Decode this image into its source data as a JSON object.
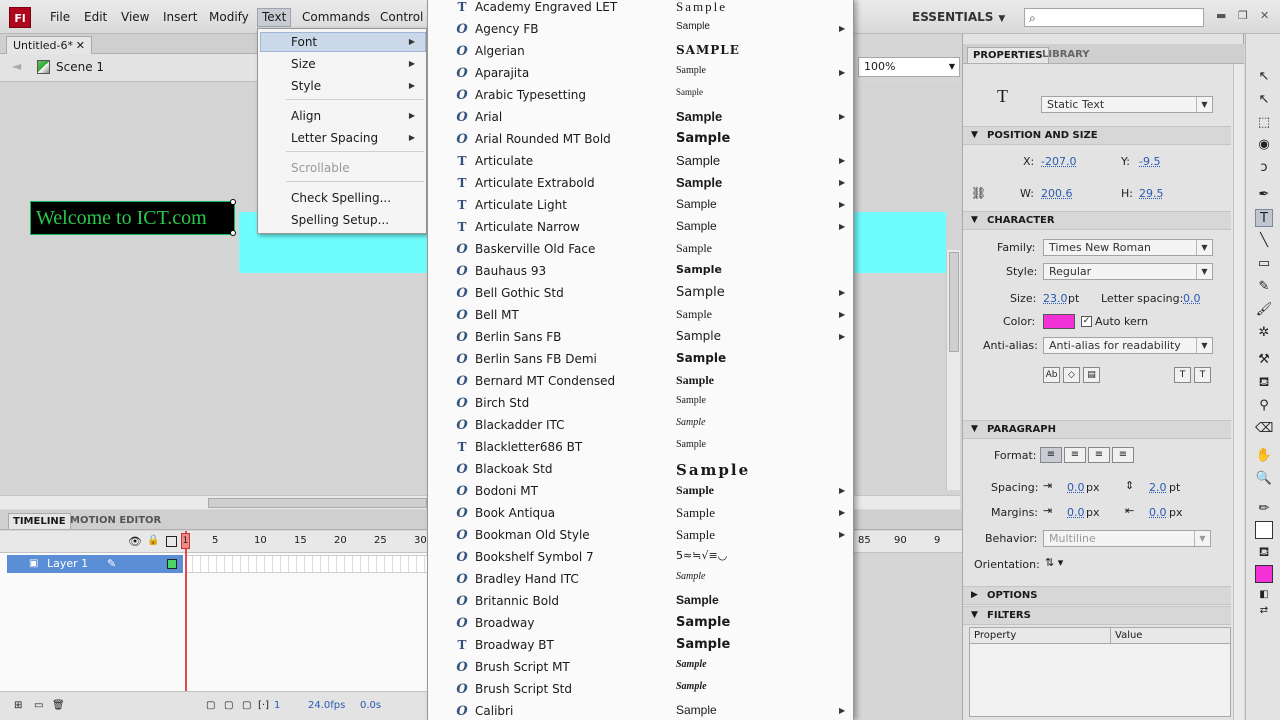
{
  "app": {
    "logo": "Fl"
  },
  "menubar": {
    "items": [
      "File",
      "Edit",
      "View",
      "Insert",
      "Modify",
      "Text",
      "Commands",
      "Control"
    ],
    "workspace": "ESSENTIALS"
  },
  "document": {
    "tab": "Untitled-6*",
    "scene": "Scene 1",
    "zoom": "100%",
    "text_object": "Welcome to ICT.com"
  },
  "text_menu": {
    "font": "Font",
    "size": "Size",
    "style": "Style",
    "align": "Align",
    "letter_spacing": "Letter Spacing",
    "scrollable": "Scrollable",
    "check_spelling": "Check Spelling...",
    "spelling_setup": "Spelling Setup..."
  },
  "font_list": [
    {
      "name": "Academy Engraved LET",
      "type": "TT",
      "sample": "Sample",
      "submenu": false
    },
    {
      "name": "Agency FB",
      "type": "O",
      "sample": "Sample",
      "submenu": true
    },
    {
      "name": "Algerian",
      "type": "O",
      "sample": "SAMPLE",
      "submenu": false
    },
    {
      "name": "Aparajita",
      "type": "O",
      "sample": "Sample",
      "submenu": true
    },
    {
      "name": "Arabic Typesetting",
      "type": "O",
      "sample": "Sample",
      "submenu": false
    },
    {
      "name": "Arial",
      "type": "O",
      "sample": "Sample",
      "submenu": true
    },
    {
      "name": "Arial Rounded MT Bold",
      "type": "O",
      "sample": "Sample",
      "submenu": false
    },
    {
      "name": "Articulate",
      "type": "TT",
      "sample": "Sample",
      "submenu": true
    },
    {
      "name": "Articulate Extrabold",
      "type": "TT",
      "sample": "Sample",
      "submenu": true
    },
    {
      "name": "Articulate Light",
      "type": "TT",
      "sample": "Sample",
      "submenu": true
    },
    {
      "name": "Articulate Narrow",
      "type": "TT",
      "sample": "Sample",
      "submenu": true
    },
    {
      "name": "Baskerville Old Face",
      "type": "O",
      "sample": "Sample",
      "submenu": false
    },
    {
      "name": "Bauhaus 93",
      "type": "O",
      "sample": "Sample",
      "submenu": false
    },
    {
      "name": "Bell Gothic Std",
      "type": "O",
      "sample": "Sample",
      "submenu": true
    },
    {
      "name": "Bell MT",
      "type": "O",
      "sample": "Sample",
      "submenu": true
    },
    {
      "name": "Berlin Sans FB",
      "type": "O",
      "sample": "Sample",
      "submenu": true
    },
    {
      "name": "Berlin Sans FB Demi",
      "type": "O",
      "sample": "Sample",
      "submenu": false
    },
    {
      "name": "Bernard MT Condensed",
      "type": "O",
      "sample": "Sample",
      "submenu": false
    },
    {
      "name": "Birch Std",
      "type": "O",
      "sample": "Sample",
      "submenu": false
    },
    {
      "name": "Blackadder ITC",
      "type": "O",
      "sample": "Sample",
      "submenu": false
    },
    {
      "name": "Blackletter686 BT",
      "type": "TT",
      "sample": "Sample",
      "submenu": false
    },
    {
      "name": "Blackoak Std",
      "type": "O",
      "sample": "Sample",
      "submenu": false
    },
    {
      "name": "Bodoni MT",
      "type": "O",
      "sample": "Sample",
      "submenu": true
    },
    {
      "name": "Book Antiqua",
      "type": "O",
      "sample": "Sample",
      "submenu": true
    },
    {
      "name": "Bookman Old Style",
      "type": "O",
      "sample": "Sample",
      "submenu": true
    },
    {
      "name": "Bookshelf Symbol 7",
      "type": "O",
      "sample": "5≈≒√≡◡",
      "submenu": false
    },
    {
      "name": "Bradley Hand ITC",
      "type": "O",
      "sample": "Sample",
      "submenu": false
    },
    {
      "name": "Britannic Bold",
      "type": "O",
      "sample": "Sample",
      "submenu": false
    },
    {
      "name": "Broadway",
      "type": "O",
      "sample": "Sample",
      "submenu": false
    },
    {
      "name": "Broadway BT",
      "type": "TT",
      "sample": "Sample",
      "submenu": false
    },
    {
      "name": "Brush Script MT",
      "type": "O",
      "sample": "Sample",
      "submenu": false
    },
    {
      "name": "Brush Script Std",
      "type": "O",
      "sample": "Sample",
      "submenu": false
    },
    {
      "name": "Calibri",
      "type": "O",
      "sample": "Sample",
      "submenu": true
    }
  ],
  "timeline": {
    "tabs": [
      "TIMELINE",
      "MOTION EDITOR"
    ],
    "ruler": [
      "1",
      "5",
      "10",
      "15",
      "20",
      "25",
      "30"
    ],
    "ruler_right": [
      "85",
      "90",
      "9"
    ],
    "layer": "Layer 1",
    "current_frame": "1",
    "fps": "24.0fps",
    "time": "0.0s"
  },
  "properties": {
    "tabs": [
      "PROPERTIES",
      "LIBRARY"
    ],
    "tool_glyph": "T",
    "text_type": "Static Text",
    "position_size": {
      "title": "POSITION AND SIZE",
      "x_label": "X:",
      "x": "-207.0",
      "y_label": "Y:",
      "y": "-9.5",
      "w_label": "W:",
      "w": "200.6",
      "h_label": "H:",
      "h": "29.5"
    },
    "character": {
      "title": "CHARACTER",
      "family_label": "Family:",
      "family": "Times New Roman",
      "style_label": "Style:",
      "style": "Regular",
      "size_label": "Size:",
      "size": "23.0",
      "size_unit": "pt",
      "letter_spacing_label": "Letter spacing:",
      "letter_spacing": "0.0",
      "color_label": "Color:",
      "color": "#f232d6",
      "auto_kern": "Auto kern",
      "anti_alias_label": "Anti-alias:",
      "anti_alias": "Anti-alias for readability"
    },
    "paragraph": {
      "title": "PARAGRAPH",
      "format_label": "Format:",
      "spacing_label": "Spacing:",
      "spacing_indent": "0.0",
      "spacing_line": "2.0",
      "px": "px",
      "pt": "pt",
      "margins_label": "Margins:",
      "margin_left": "0.0",
      "margin_right": "0.0",
      "behavior_label": "Behavior:",
      "behavior": "Multiline",
      "orientation_label": "Orientation:"
    },
    "options_title": "OPTIONS",
    "filters": {
      "title": "FILTERS",
      "property_col": "Property",
      "value_col": "Value"
    }
  }
}
